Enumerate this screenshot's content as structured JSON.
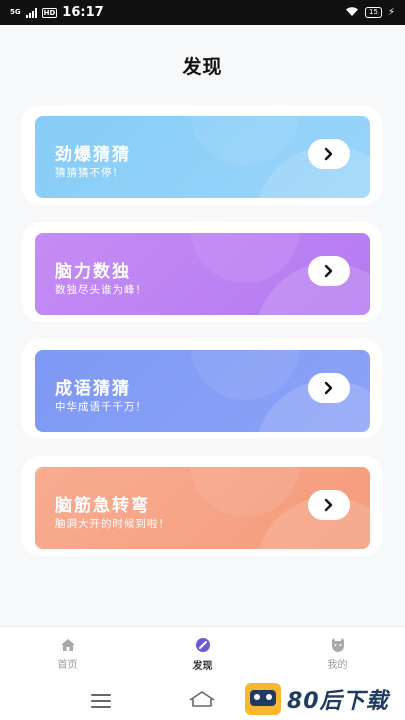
{
  "status_bar": {
    "network": "5G",
    "hd": "HD",
    "time": "16:17",
    "battery": "15"
  },
  "page": {
    "title": "发现"
  },
  "cards": [
    {
      "title": "劲爆猜猜",
      "subtitle": "猜猜猜不停！",
      "color": "#8fd0f8"
    },
    {
      "title": "脑力数独",
      "subtitle": "数独尽头谁为峰！",
      "color": "#bd84f3"
    },
    {
      "title": "成语猜猜",
      "subtitle": "中华成语千千万！",
      "color": "#869df6"
    },
    {
      "title": "脑筋急转弯",
      "subtitle": "脑洞大开的时候到啦！",
      "color": "#f7a486"
    }
  ],
  "tabs": [
    {
      "label": "首页",
      "icon": "home-icon",
      "active": false
    },
    {
      "label": "发现",
      "icon": "discover-icon",
      "active": true
    },
    {
      "label": "我的",
      "icon": "profile-icon",
      "active": false
    }
  ],
  "watermark": {
    "text": "80后下载"
  }
}
